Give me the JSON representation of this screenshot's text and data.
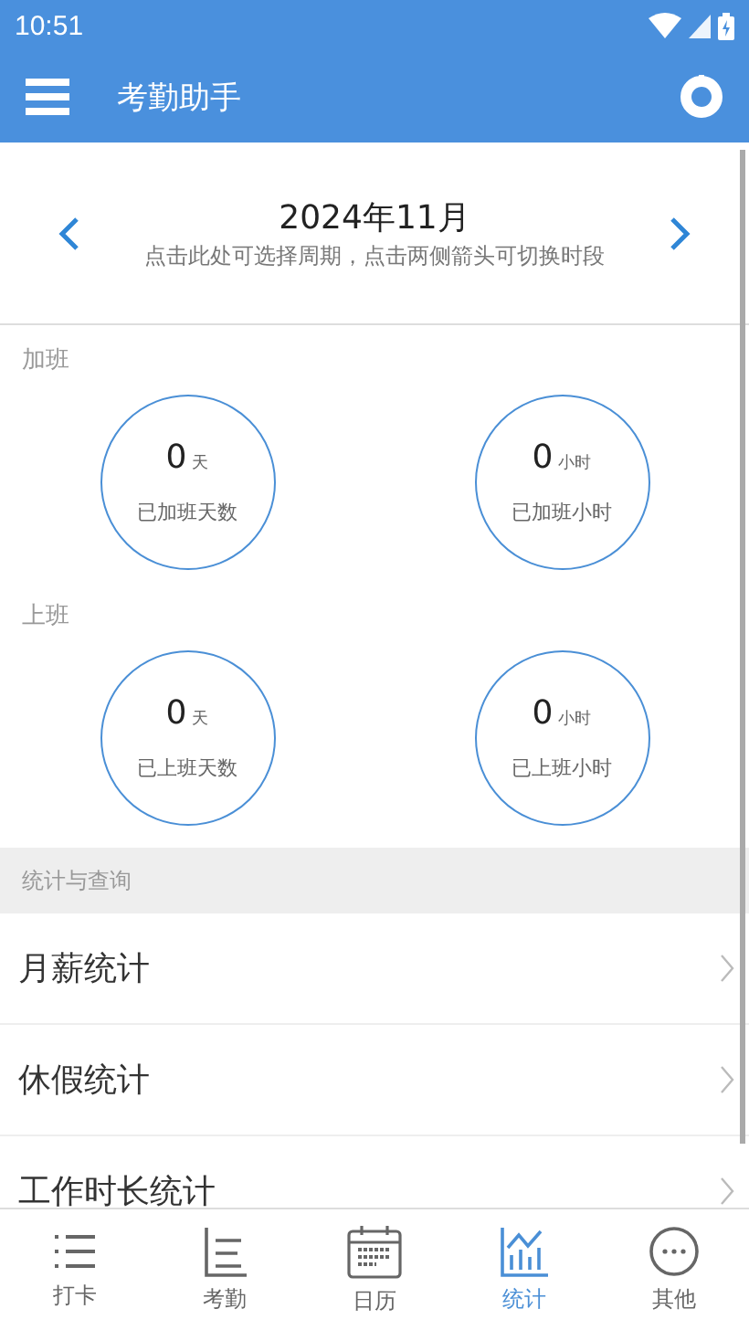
{
  "status_bar": {
    "time": "10:51"
  },
  "app_bar": {
    "title": "考勤助手"
  },
  "period": {
    "title": "2024年11月",
    "hint": "点击此处可选择周期，点击两侧箭头可切换时段"
  },
  "sections": [
    {
      "title": "加班",
      "stats": [
        {
          "value": "0",
          "unit": "天",
          "label": "已加班天数"
        },
        {
          "value": "0",
          "unit": "小时",
          "label": "已加班小时"
        }
      ]
    },
    {
      "title": "上班",
      "stats": [
        {
          "value": "0",
          "unit": "天",
          "label": "已上班天数"
        },
        {
          "value": "0",
          "unit": "小时",
          "label": "已上班小时"
        }
      ]
    }
  ],
  "query": {
    "header": "统计与查询",
    "items": [
      "月薪统计",
      "休假统计",
      "工作时长统计"
    ]
  },
  "nav": [
    {
      "kind": "list",
      "label": "打卡",
      "selected": false
    },
    {
      "kind": "attendance",
      "label": "考勤",
      "selected": false
    },
    {
      "kind": "calendar",
      "label": "日历",
      "selected": false
    },
    {
      "kind": "chart",
      "label": "统计",
      "selected": true
    },
    {
      "kind": "more",
      "label": "其他",
      "selected": false
    }
  ]
}
